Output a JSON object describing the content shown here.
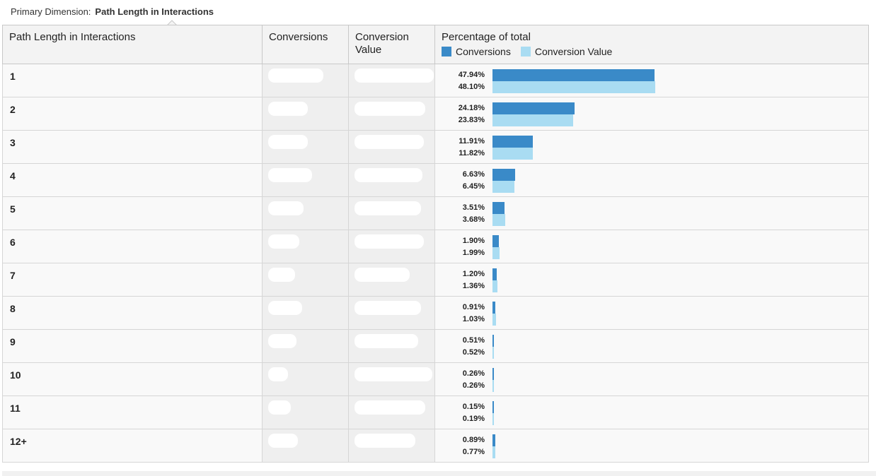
{
  "primary_dimension": {
    "label": "Primary Dimension:",
    "value": "Path Length in Interactions"
  },
  "columns": {
    "dimension": "Path Length in Interactions",
    "conversions": "Conversions",
    "conversion_value": "Conversion Value",
    "percentage": "Percentage of total"
  },
  "legend": [
    {
      "label": "Conversions",
      "color": "#3a8ac8"
    },
    {
      "label": "Conversion Value",
      "color": "#a9dcf2"
    }
  ],
  "rows": [
    {
      "path_length": "1",
      "conversions_pct": "47.94%",
      "value_pct": "48.10%",
      "c": 47.94,
      "v": 48.1
    },
    {
      "path_length": "2",
      "conversions_pct": "24.18%",
      "value_pct": "23.83%",
      "c": 24.18,
      "v": 23.83
    },
    {
      "path_length": "3",
      "conversions_pct": "11.91%",
      "value_pct": "11.82%",
      "c": 11.91,
      "v": 11.82
    },
    {
      "path_length": "4",
      "conversions_pct": "6.63%",
      "value_pct": "6.45%",
      "c": 6.63,
      "v": 6.45
    },
    {
      "path_length": "5",
      "conversions_pct": "3.51%",
      "value_pct": "3.68%",
      "c": 3.51,
      "v": 3.68
    },
    {
      "path_length": "6",
      "conversions_pct": "1.90%",
      "value_pct": "1.99%",
      "c": 1.9,
      "v": 1.99
    },
    {
      "path_length": "7",
      "conversions_pct": "1.20%",
      "value_pct": "1.36%",
      "c": 1.2,
      "v": 1.36
    },
    {
      "path_length": "8",
      "conversions_pct": "0.91%",
      "value_pct": "1.03%",
      "c": 0.91,
      "v": 1.03
    },
    {
      "path_length": "9",
      "conversions_pct": "0.51%",
      "value_pct": "0.52%",
      "c": 0.51,
      "v": 0.52
    },
    {
      "path_length": "10",
      "conversions_pct": "0.26%",
      "value_pct": "0.26%",
      "c": 0.26,
      "v": 0.26
    },
    {
      "path_length": "11",
      "conversions_pct": "0.15%",
      "value_pct": "0.19%",
      "c": 0.15,
      "v": 0.19
    },
    {
      "path_length": "12+",
      "conversions_pct": "0.89%",
      "value_pct": "0.77%",
      "c": 0.89,
      "v": 0.77
    }
  ],
  "chart_data": {
    "type": "bar",
    "title": "Percentage of total",
    "categories": [
      "1",
      "2",
      "3",
      "4",
      "5",
      "6",
      "7",
      "8",
      "9",
      "10",
      "11",
      "12+"
    ],
    "series": [
      {
        "name": "Conversions",
        "color": "#3a8ac8",
        "values": [
          47.94,
          24.18,
          11.91,
          6.63,
          3.51,
          1.9,
          1.2,
          0.91,
          0.51,
          0.26,
          0.15,
          0.89
        ]
      },
      {
        "name": "Conversion Value",
        "color": "#a9dcf2",
        "values": [
          48.1,
          23.83,
          11.82,
          6.45,
          3.68,
          1.99,
          1.36,
          1.03,
          0.52,
          0.26,
          0.19,
          0.77
        ]
      }
    ],
    "xlabel": "",
    "ylabel": "",
    "orientation": "horizontal",
    "xlim": [
      0,
      48.1
    ]
  }
}
